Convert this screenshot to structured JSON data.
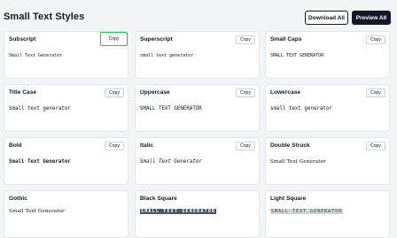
{
  "header": {
    "title": "Small Text Styles",
    "download_label": "Download All",
    "preview_label": "Preview All"
  },
  "copy_label": "Copy",
  "cards": [
    {
      "title": "Subscript",
      "sample": "Small Text Generator"
    },
    {
      "title": "Superscript",
      "sample": "small text generator"
    },
    {
      "title": "Small Caps",
      "sample": "SMALL TEXT GENERATOR"
    },
    {
      "title": "Title Case",
      "sample": "Small text generator"
    },
    {
      "title": "Uppercase",
      "sample": "SMALL TEXT GENERATOR"
    },
    {
      "title": "Lowercase",
      "sample": "small text generator"
    },
    {
      "title": "Bold",
      "sample": "Small Text Generator"
    },
    {
      "title": "Italic",
      "sample": "Small Text Generator"
    },
    {
      "title": "Double Struck",
      "sample": "Small Text Generator"
    },
    {
      "title": "Gothic",
      "sample": "Small Text Generator"
    },
    {
      "title": "Black Square",
      "sample": "SMALL TEXT GENERATOR"
    },
    {
      "title": "Light Square",
      "sample": "SMALL TEXT GENERATOR"
    }
  ]
}
